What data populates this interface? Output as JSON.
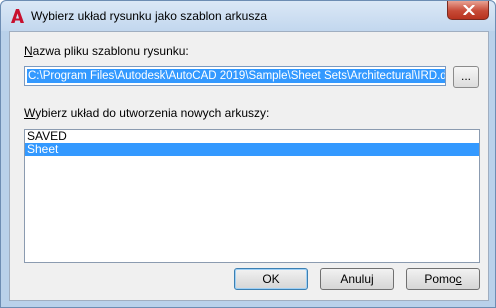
{
  "window": {
    "title": "Wybierz układ rysunku jako szablon arkusza",
    "close_icon": "close-icon",
    "app_icon": "autocad-logo-icon"
  },
  "template_file": {
    "label_ul": "N",
    "label_rest": "azwa pliku szablonu rysunku:",
    "value": "C:\\Program Files\\Autodesk\\AutoCAD 2019\\Sample\\Sheet Sets\\Architectural\\IRD.dwt",
    "browse_label": "..."
  },
  "layout_list": {
    "label_ul": "W",
    "label_rest": "ybierz układ do utworzenia nowych arkuszy:",
    "items": [
      "SAVED",
      "Sheet"
    ],
    "selected_index": 1
  },
  "buttons": {
    "ok": "OK",
    "cancel_pre": "Anulu",
    "cancel_ul": "j",
    "help_pre": "Pomo",
    "help_ul": "c"
  },
  "colors": {
    "selection": "#3399ff",
    "accent_close": "#c74a37"
  }
}
